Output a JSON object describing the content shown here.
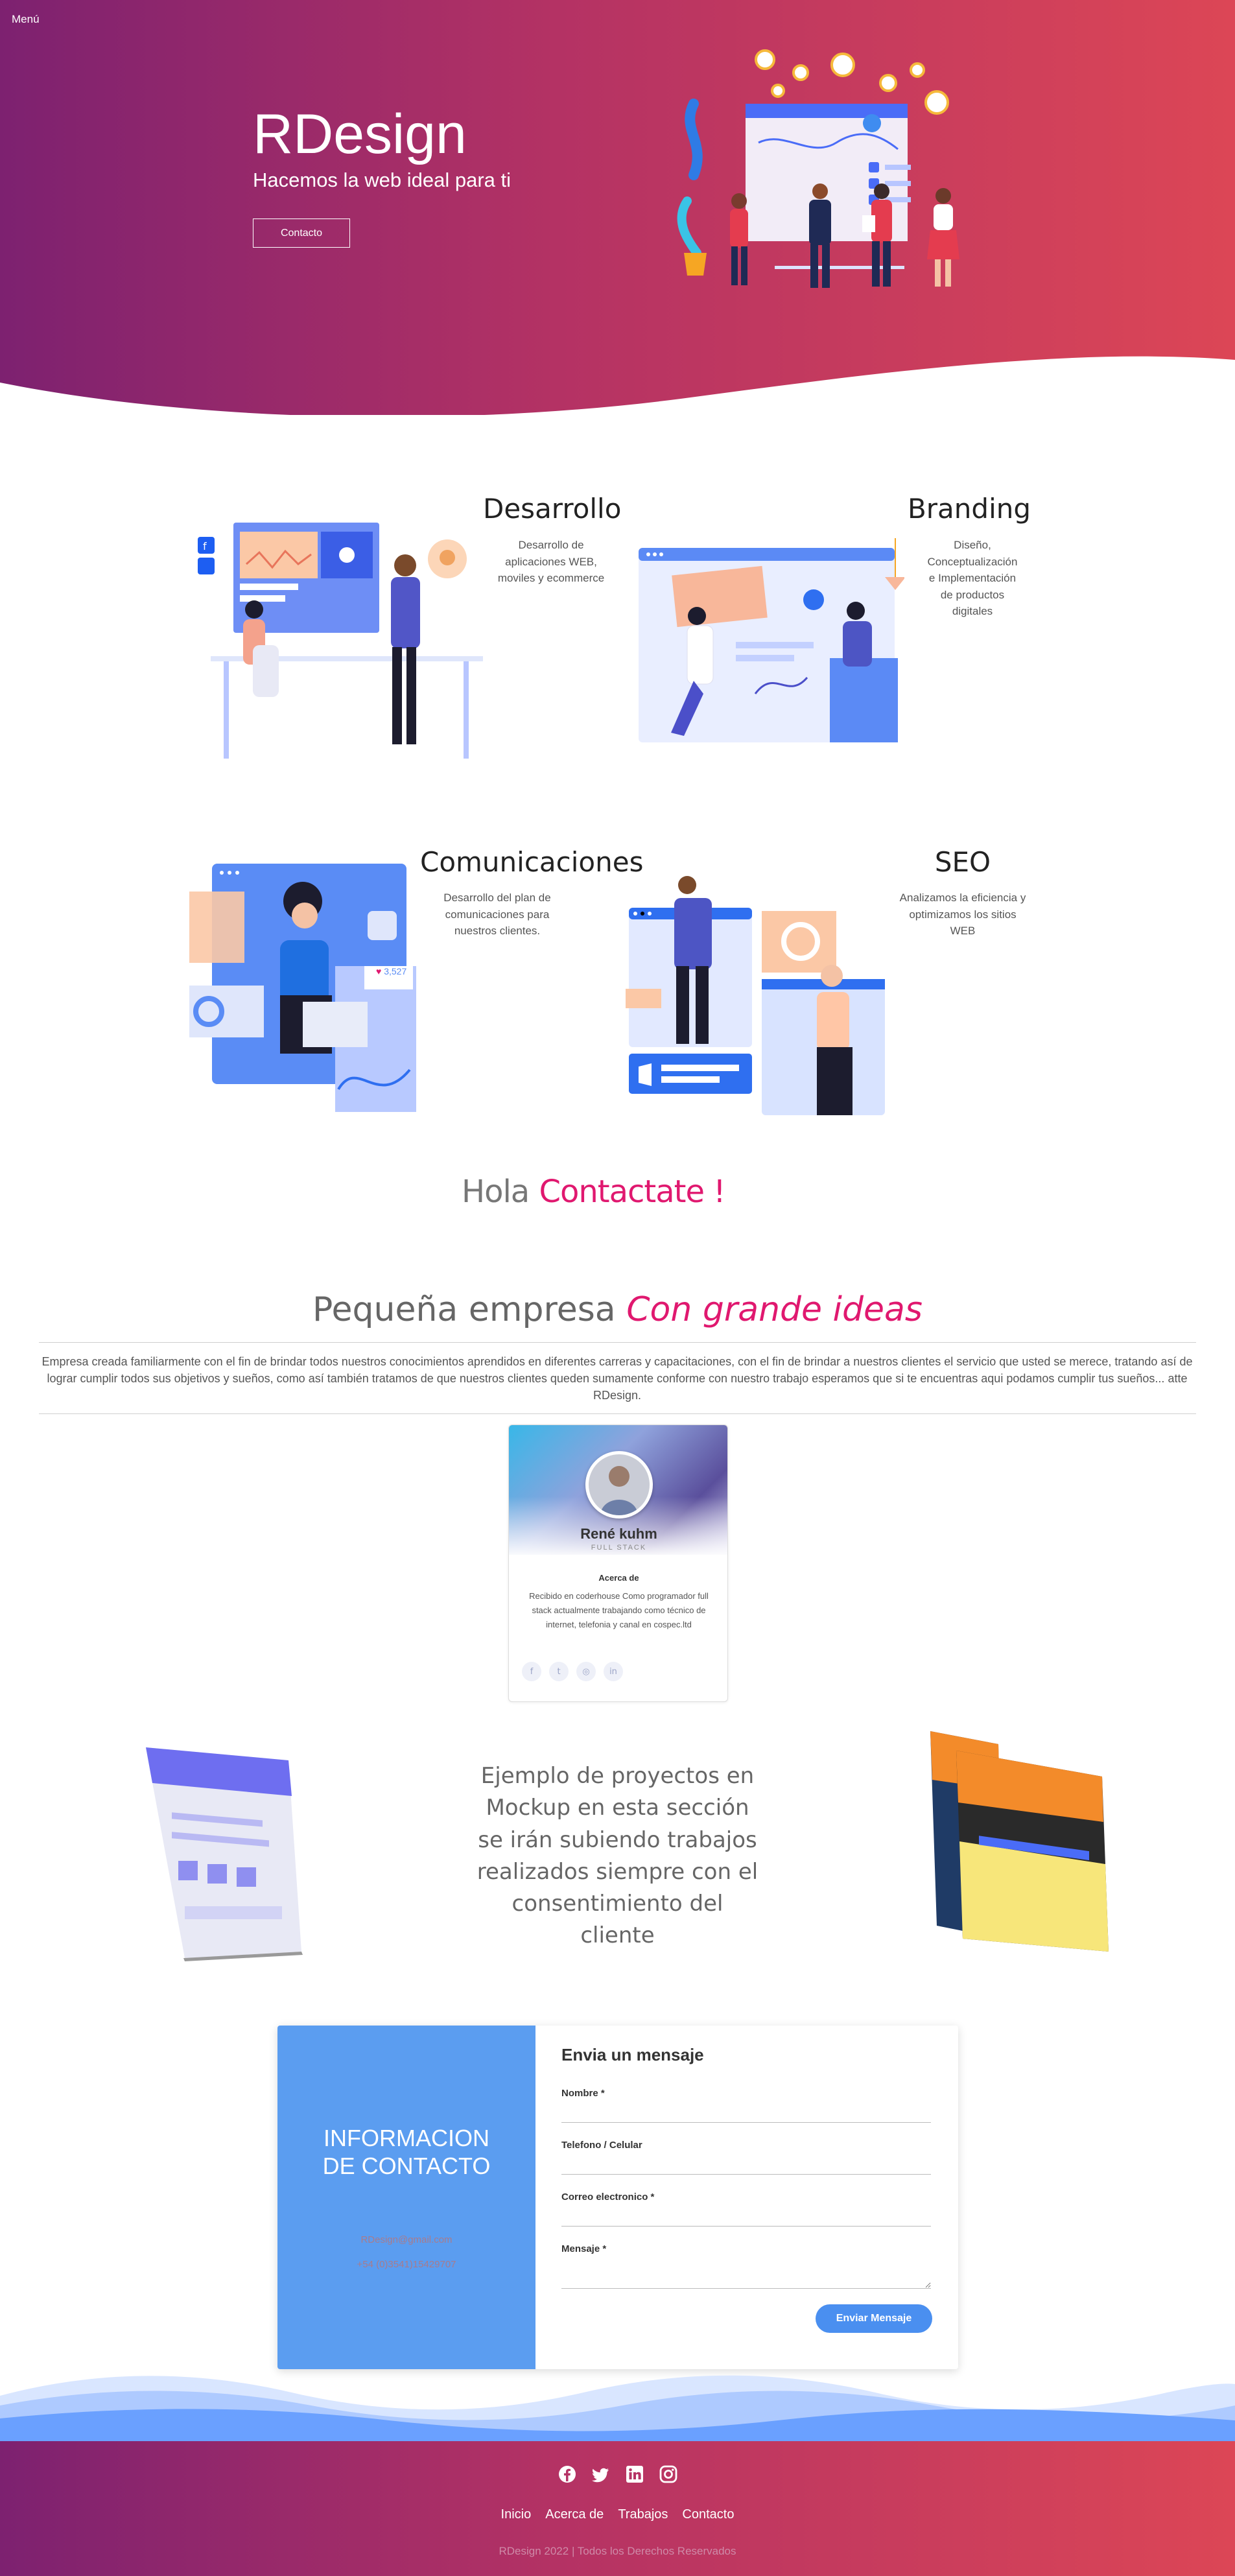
{
  "header": {
    "menu_label": "Menú"
  },
  "hero": {
    "title": "RDesign",
    "subtitle": "Hacemos la web ideal para ti",
    "cta_label": "Contacto"
  },
  "services": [
    {
      "title": "Desarrollo",
      "description": "Desarrollo de aplicaciones WEB, moviles y ecommerce"
    },
    {
      "title": "Branding",
      "description": "Diseño, Conceptualización e Implementación de productos digitales"
    },
    {
      "title": "Comunicaciones",
      "description": "Desarrollo del plan de comunicaciones para nuestros clientes."
    },
    {
      "title": "SEO",
      "description": "Analizamos la eficiencia y optimizamos los sitios WEB"
    }
  ],
  "illustration_texts": {
    "likes": "3,527"
  },
  "hola": {
    "part1": "Hola",
    "part2": "Contactate !"
  },
  "about": {
    "title_plain": "Pequeña empresa",
    "title_accent": "Con grande ideas",
    "text": "Empresa creada familiarmente con el fin de brindar todos nuestros conocimientos aprendidos en diferentes carreras y capacitaciones, con el fin de brindar a nuestros clientes el servicio que usted se merece, tratando así de lograr cumplir todos sus objetivos y sueños, como así también tratamos de que nuestros clientes queden sumamente conforme con nuestro trabajo esperamos que si te encuentras aqui podamos cumplir tus sueños... atte RDesign."
  },
  "profile": {
    "name": "René kuhm",
    "role": "FULL STACK",
    "about_heading": "Acerca de",
    "about_text": "Recibido en coderhouse Como programador full stack actualmente trabajando como técnico de internet, telefonia y canal en cospec.ltd",
    "social": [
      "f",
      "t",
      "◎",
      "in"
    ]
  },
  "projects": {
    "text": "Ejemplo de proyectos en Mockup en esta sección se irán subiendo trabajos realizados siempre con el consentimiento del cliente"
  },
  "contact": {
    "info_heading_line1": "INFORMACION",
    "info_heading_line2": "DE CONTACTO",
    "email": "RDesign@gmail.com",
    "phone": "+54 (0)3541)15429707",
    "form_title": "Envia un mensaje",
    "name_label": "Nombre *",
    "phone_label": "Telefono / Celular",
    "email_label": "Correo electronico *",
    "message_label": "Mensaje *",
    "submit_label": "Enviar Mensaje"
  },
  "footer": {
    "icons": [
      "facebook-icon",
      "twitter-icon",
      "linkedin-icon",
      "instagram-icon"
    ],
    "nav": [
      "Inicio",
      "Acerca de",
      "Trabajos",
      "Contacto"
    ],
    "copyright": "RDesign 2022 | Todos los Derechos Reservados"
  },
  "colors": {
    "gradient_start": "#7d2170",
    "gradient_end": "#dc4656",
    "accent_pink": "#e0186f",
    "contact_blue": "#5b9df0",
    "button_blue": "#4a8ff0"
  }
}
